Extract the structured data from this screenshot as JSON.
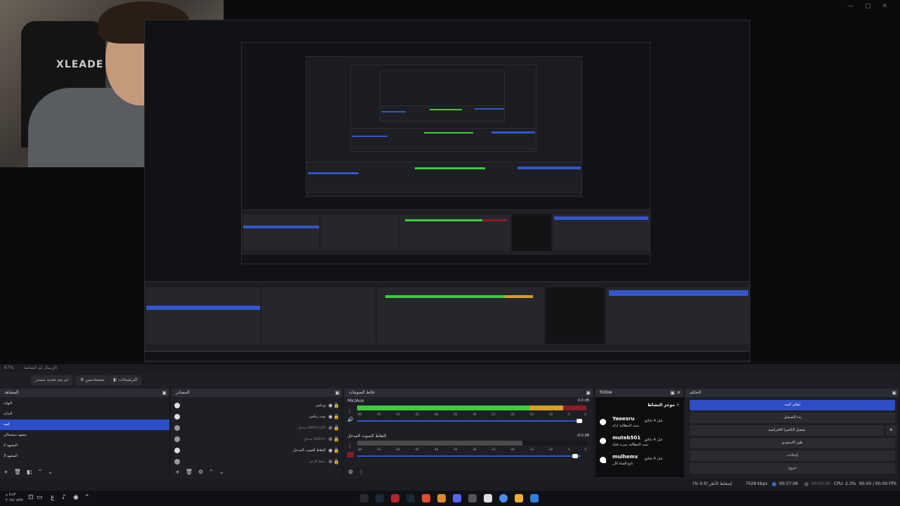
{
  "window": {
    "minimize": "—",
    "maximize": "▢",
    "close": "✕"
  },
  "preview": {
    "brand_text": "XLEADE"
  },
  "scene_strip": {
    "zoom": "67%",
    "label": "الإرسال لم الشاشة"
  },
  "toolbar": {
    "transitions_btn": "الترشيحات",
    "studio_btn": "مستخدمين",
    "no_source_btn": "لم يتم تحديد مصدر"
  },
  "scenes": {
    "title": "المشاهد",
    "items": [
      {
        "label": "النهايه",
        "active": false
      },
      {
        "label": "البدايه",
        "active": false
      },
      {
        "label": "لعبه",
        "active": true
      },
      {
        "label": "مشهد سيجمالي",
        "active": false
      },
      {
        "label": "المشهد 2",
        "active": false
      },
      {
        "label": "المشهد 3",
        "active": false
      }
    ]
  },
  "sources": {
    "title": "المصادر",
    "items": [
      {
        "label": "وربلس",
        "dim": false
      },
      {
        "label": "بوت زيكس",
        "dim": false
      },
      {
        "label": "مدخل (GDI+) (2)",
        "dim": true
      },
      {
        "label": "مدخل (GDI+)",
        "dim": true
      },
      {
        "label": "التقاط الصوت المدخل",
        "dim": false
      },
      {
        "label": "رابط الدعم",
        "dim": true
      }
    ]
  },
  "mixer": {
    "title": "خلاط الصوتيات",
    "channels": [
      {
        "name": "Mic/Aux",
        "db": "0.0 dB",
        "level": 0.9,
        "dim": false
      },
      {
        "name": "التقاط الصوت المدخل",
        "db": "-0.0 dB",
        "level": 0.72,
        "dim": true
      }
    ],
    "ticks": [
      "-60",
      "-55",
      "-50",
      "-45",
      "-40",
      "-35",
      "-30",
      "-25",
      "-20",
      "-15",
      "-10",
      "-5",
      "0"
    ]
  },
  "follow": {
    "title": "follow",
    "widget_title": "موجز النشاط",
    "rows": [
      {
        "name": "Yaeesru",
        "sub": "تمت المطالبة ارام",
        "time": "قبل 4 دقائق"
      },
      {
        "name": "muteb501",
        "sub": "تمت المطالبة سرت قيلة",
        "time": "قبل 4 دقائق"
      },
      {
        "name": "mulhemx",
        "sub": "تابع القناة الآن",
        "time": "قبل 4 دقائق"
      }
    ]
  },
  "controls": {
    "title": "التحكم",
    "buttons": [
      {
        "label": "ايقاف البث",
        "primary": true
      },
      {
        "label": "بدء التسجيل",
        "primary": false
      },
      {
        "label": "تشغيل الكاميرا الافتراضية",
        "primary": false
      },
      {
        "label": "طور الاستوديو",
        "primary": false
      },
      {
        "label": "إعدادات",
        "primary": false
      },
      {
        "label": "خروج",
        "primary": false
      }
    ]
  },
  "statusbar": {
    "dropped": "إسقاط الأطر (0.0 %)",
    "bitrate": "7028 kbps",
    "live_time": "00:37:06",
    "rec_time": "00:00:00",
    "cpu": "CPU: 2.3%",
    "fps": "60.00 / 60.00 FPS"
  },
  "taskbar": {
    "time": "٥:٤٣ م",
    "date": "٢٠٢٤/٠٨/٢٧",
    "lang": "ع"
  }
}
